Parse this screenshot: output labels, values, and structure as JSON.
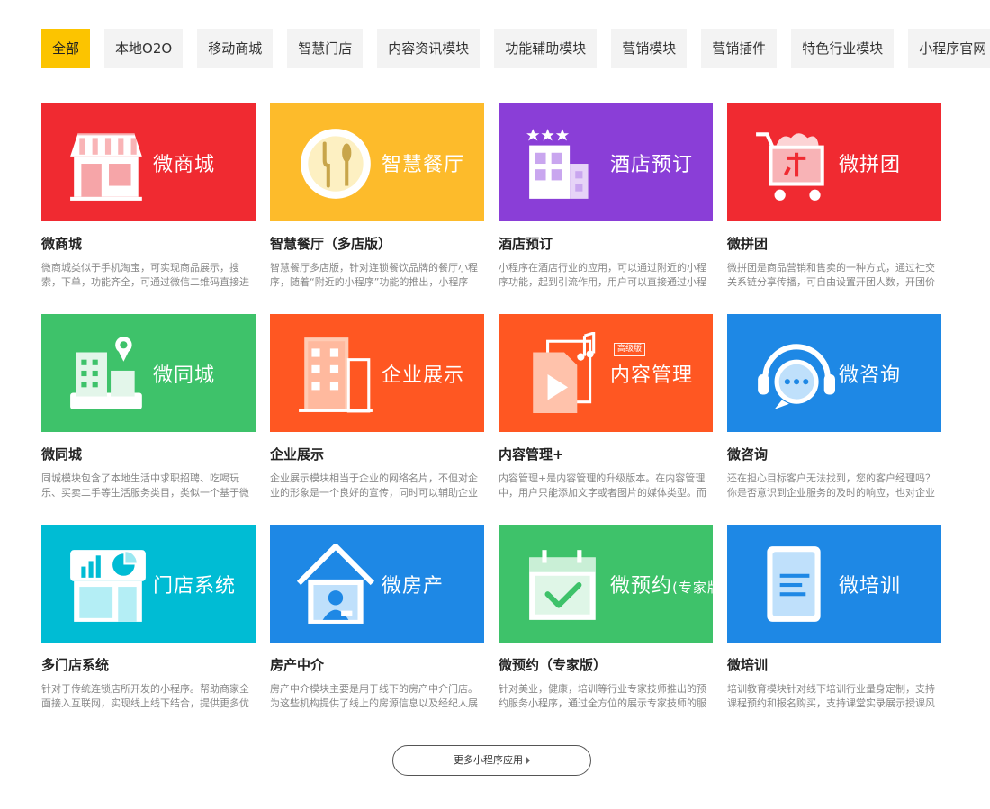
{
  "tabs": [
    "全部",
    "本地O2O",
    "移动商城",
    "智慧门店",
    "内容资讯模块",
    "功能辅助模块",
    "营销模块",
    "营销插件",
    "特色行业模块",
    "小程序官网"
  ],
  "cards": [
    {
      "banner": "微商城",
      "title": "微商城",
      "desc": "微商城类似于手机淘宝，可实现商品展示，搜索，下单，功能齐全，可通过微信二维码直接进",
      "color": "#f02a31",
      "icon": "shop-icon"
    },
    {
      "banner": "智慧餐厅",
      "title": "智慧餐厅（多店版）",
      "desc": "智慧餐厅多店版，针对连锁餐饮品牌的餐厅小程序，随着“附近的小程序”功能的推出，小程序",
      "color": "#fdbb2b",
      "icon": "dining-plate-icon"
    },
    {
      "banner": "酒店预订",
      "title": "酒店预订",
      "desc": "小程序在酒店行业的应用，可以通过附近的小程序功能，起到引流作用，用户可以直接通过小程",
      "color": "#8a3ed7",
      "icon": "hotel-icon"
    },
    {
      "banner": "微拼团",
      "title": "微拼团",
      "desc": "微拼团是商品营销和售卖的一种方式，通过社交关系链分享传播，可自由设置开团人数，开团价",
      "color": "#f02a31",
      "icon": "shopping-cart-icon"
    },
    {
      "banner": "微同城",
      "title": "微同城",
      "desc": "同城模块包含了本地生活中求职招聘、吃喝玩乐、买卖二手等生活服务类目，类似一个基于微",
      "color": "#3ec26a",
      "icon": "city-location-icon"
    },
    {
      "banner": "企业展示",
      "title": "企业展示",
      "desc": "企业展示模块相当于企业的网络名片，不但对企业的形象是一个良好的宣传，同时可以辅助企业",
      "color": "#ff5722",
      "icon": "building-icon"
    },
    {
      "banner": "内容管理",
      "badge": "高级版",
      "title": "内容管理+",
      "desc": "内容管理+是内容管理的升级版本。在内容管理中，用户只能添加文字或者图片的媒体类型。而",
      "color": "#ff5722",
      "icon": "media-content-icon"
    },
    {
      "banner": "微咨询",
      "title": "微咨询",
      "desc": "还在担心目标客户无法找到，您的客户经理吗？你是否意识到企业服务的及时的响应，也对企业",
      "color": "#1e88e5",
      "icon": "headset-chat-icon"
    },
    {
      "banner": "门店系统",
      "title": "多门店系统",
      "desc": "针对于传统连锁店所开发的小程序。帮助商家全面接入互联网，实现线上线下结合，提供更多优",
      "color": "#00bcd4",
      "icon": "store-chart-icon"
    },
    {
      "banner": "微房产",
      "title": "房产中介",
      "desc": "房产中介模块主要是用于线下的房产中介门店。为这些机构提供了线上的房源信息以及经纪人展",
      "color": "#1e88e5",
      "icon": "house-agent-icon"
    },
    {
      "banner": "微预约",
      "banner_sub": "(专家版)",
      "title": "微预约（专家版）",
      "desc": "针对美业，健康，培训等行业专家技师推出的预约服务小程序，通过全方位的展示专家技师的服",
      "color": "#3ec26a",
      "icon": "calendar-check-icon"
    },
    {
      "banner": "微培训",
      "title": "微培训",
      "desc": "培训教育模块针对线下培训行业量身定制，支持课程预约和报名购买，支持课堂实录展示授课风",
      "color": "#1e88e5",
      "icon": "book-icon"
    }
  ],
  "more_label": "更多小程序应用"
}
